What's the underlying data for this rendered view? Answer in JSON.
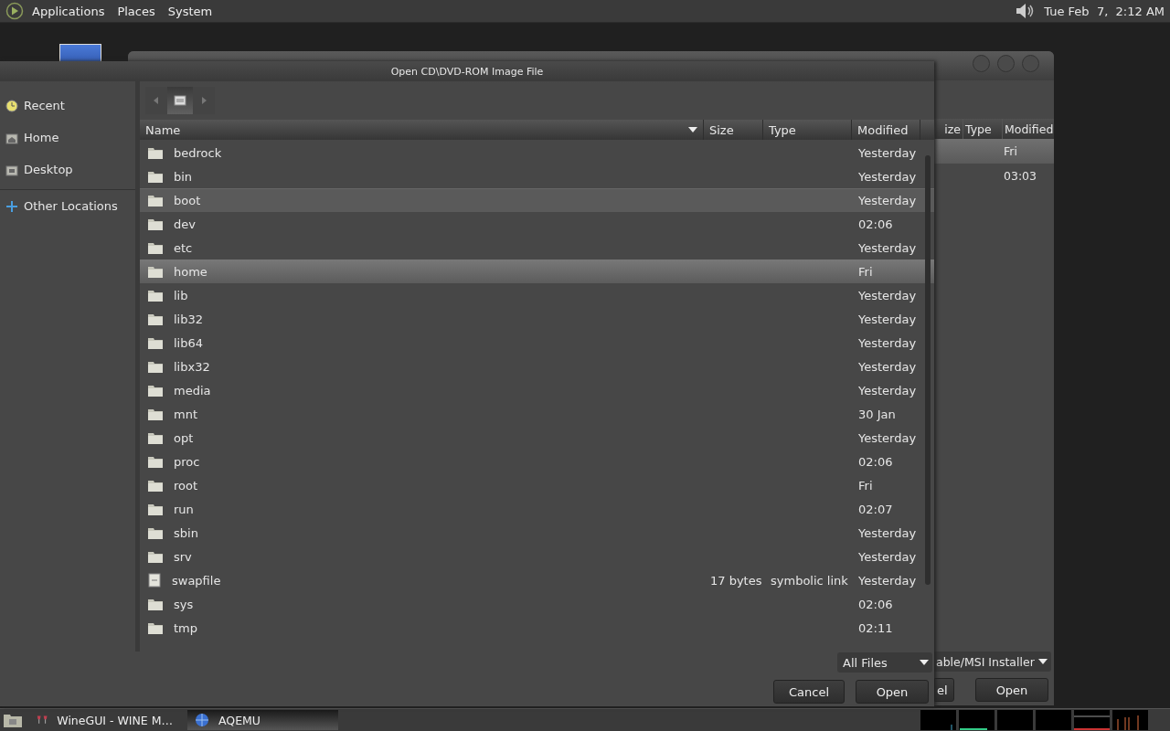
{
  "top_panel": {
    "menus": [
      "Applications",
      "Places",
      "System"
    ],
    "clock": "Tue Feb  7,  2:12 AM"
  },
  "back_window": {
    "columns": [
      "ize",
      "Type",
      "Modified"
    ],
    "rows": [
      {
        "modified": "Fri",
        "selected": true
      },
      {
        "modified": "03:03",
        "selected": false
      }
    ],
    "filter": "able/MSI Installer",
    "buttons": [
      "el",
      "Open"
    ]
  },
  "dialog": {
    "title": "Open CD\\DVD-ROM Image File",
    "places": [
      {
        "label": "Recent",
        "kind": "recent"
      },
      {
        "label": "Home",
        "kind": "home"
      },
      {
        "label": "Desktop",
        "kind": "desktop"
      },
      {
        "label": "Other Locations",
        "kind": "other"
      }
    ],
    "columns": [
      "Name",
      "Size",
      "Type",
      "Modified"
    ],
    "rows": [
      {
        "name": "bedrock",
        "kind": "folder",
        "modified": "Yesterday",
        "selected": false,
        "hovered": false
      },
      {
        "name": "bin",
        "kind": "folder",
        "modified": "Yesterday",
        "selected": false,
        "hovered": false
      },
      {
        "name": "boot",
        "kind": "folder",
        "modified": "Yesterday",
        "selected": false,
        "hovered": true
      },
      {
        "name": "dev",
        "kind": "folder",
        "modified": "02:06",
        "selected": false,
        "hovered": false
      },
      {
        "name": "etc",
        "kind": "folder",
        "modified": "Yesterday",
        "selected": false,
        "hovered": false
      },
      {
        "name": "home",
        "kind": "folder",
        "modified": "Fri",
        "selected": true,
        "hovered": false
      },
      {
        "name": "lib",
        "kind": "folder",
        "modified": "Yesterday",
        "selected": false,
        "hovered": false
      },
      {
        "name": "lib32",
        "kind": "folder",
        "modified": "Yesterday",
        "selected": false,
        "hovered": false
      },
      {
        "name": "lib64",
        "kind": "folder",
        "modified": "Yesterday",
        "selected": false,
        "hovered": false
      },
      {
        "name": "libx32",
        "kind": "folder",
        "modified": "Yesterday",
        "selected": false,
        "hovered": false
      },
      {
        "name": "media",
        "kind": "folder",
        "modified": "Yesterday",
        "selected": false,
        "hovered": false
      },
      {
        "name": "mnt",
        "kind": "folder",
        "modified": "30 Jan",
        "selected": false,
        "hovered": false
      },
      {
        "name": "opt",
        "kind": "folder",
        "modified": "Yesterday",
        "selected": false,
        "hovered": false
      },
      {
        "name": "proc",
        "kind": "folder",
        "modified": "02:06",
        "selected": false,
        "hovered": false
      },
      {
        "name": "root",
        "kind": "folder",
        "modified": "Fri",
        "selected": false,
        "hovered": false
      },
      {
        "name": "run",
        "kind": "folder",
        "modified": "02:07",
        "selected": false,
        "hovered": false
      },
      {
        "name": "sbin",
        "kind": "folder",
        "modified": "Yesterday",
        "selected": false,
        "hovered": false
      },
      {
        "name": "srv",
        "kind": "folder",
        "modified": "Yesterday",
        "selected": false,
        "hovered": false
      },
      {
        "name": "swapfile",
        "kind": "file",
        "size": "17 bytes",
        "type": "symbolic link",
        "modified": "Yesterday",
        "selected": false,
        "hovered": false
      },
      {
        "name": "sys",
        "kind": "folder",
        "modified": "02:06",
        "selected": false,
        "hovered": false
      },
      {
        "name": "tmp",
        "kind": "folder",
        "modified": "02:11",
        "selected": false,
        "hovered": false
      }
    ],
    "filter": "All Files",
    "buttons": [
      "Cancel",
      "Open"
    ]
  },
  "taskbar": {
    "items": [
      {
        "label": "WineGUI - WINE M…",
        "kind": "wine",
        "selected": false
      },
      {
        "label": "AQEMU",
        "kind": "qemu",
        "selected": true
      }
    ]
  }
}
